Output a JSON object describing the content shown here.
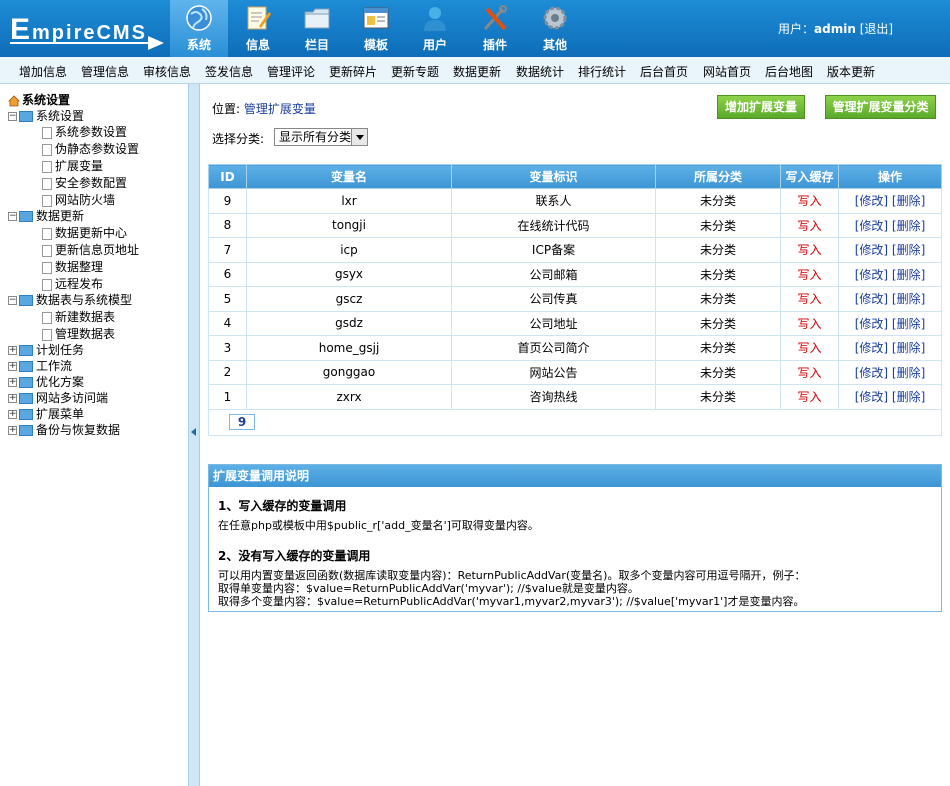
{
  "logo": {
    "text_big": "E",
    "text_rest": "mpireCMS"
  },
  "nav": [
    {
      "label": "系统",
      "icon": "globe-icon",
      "active": true
    },
    {
      "label": "信息",
      "icon": "document-pencil-icon",
      "active": false
    },
    {
      "label": "栏目",
      "icon": "folder-icon",
      "active": false
    },
    {
      "label": "模板",
      "icon": "window-template-icon",
      "active": false
    },
    {
      "label": "用户",
      "icon": "user-icon",
      "active": false
    },
    {
      "label": "插件",
      "icon": "tools-icon",
      "active": false
    },
    {
      "label": "其他",
      "icon": "gear-icon",
      "active": false
    }
  ],
  "user": {
    "prefix": "用户：",
    "name": "admin",
    "logout": "[退出]"
  },
  "submenu": [
    "增加信息",
    "管理信息",
    "审核信息",
    "签发信息",
    "管理评论",
    "更新碎片",
    "更新专题",
    "数据更新",
    "数据统计",
    "排行统计",
    "后台首页",
    "网站首页",
    "后台地图",
    "版本更新"
  ],
  "sidebar": {
    "root": "系统设置",
    "groups": [
      {
        "label": "系统设置",
        "expanded": true,
        "children": [
          "系统参数设置",
          "伪静态参数设置",
          "扩展变量",
          "安全参数配置",
          "网站防火墙"
        ]
      },
      {
        "label": "数据更新",
        "expanded": true,
        "children": [
          "数据更新中心",
          "更新信息页地址",
          "数据整理",
          "远程发布"
        ]
      },
      {
        "label": "数据表与系统模型",
        "expanded": true,
        "children": [
          "新建数据表",
          "管理数据表"
        ]
      },
      {
        "label": "计划任务",
        "expanded": false,
        "children": []
      },
      {
        "label": "工作流",
        "expanded": false,
        "children": []
      },
      {
        "label": "优化方案",
        "expanded": false,
        "children": []
      },
      {
        "label": "网站多访问端",
        "expanded": false,
        "children": []
      },
      {
        "label": "扩展菜单",
        "expanded": false,
        "children": []
      },
      {
        "label": "备份与恢复数据",
        "expanded": false,
        "children": []
      }
    ]
  },
  "location": {
    "prefix": "位置: ",
    "link": "管理扩展变量"
  },
  "buttons": {
    "add_var": "增加扩展变量",
    "manage_class": "管理扩展变量分类"
  },
  "filter": {
    "label": "选择分类:",
    "selected": "显示所有分类"
  },
  "table": {
    "headers": [
      "ID",
      "变量名",
      "变量标识",
      "所属分类",
      "写入缓存",
      "操作"
    ],
    "rows": [
      {
        "id": "9",
        "name": "lxr",
        "title": "联系人",
        "class": "未分类",
        "cache": "写入"
      },
      {
        "id": "8",
        "name": "tongji",
        "title": "在线统计代码",
        "class": "未分类",
        "cache": "写入"
      },
      {
        "id": "7",
        "name": "icp",
        "title": "ICP备案",
        "class": "未分类",
        "cache": "写入"
      },
      {
        "id": "6",
        "name": "gsyx",
        "title": "公司邮箱",
        "class": "未分类",
        "cache": "写入"
      },
      {
        "id": "5",
        "name": "gscz",
        "title": "公司传真",
        "class": "未分类",
        "cache": "写入"
      },
      {
        "id": "4",
        "name": "gsdz",
        "title": "公司地址",
        "class": "未分类",
        "cache": "写入"
      },
      {
        "id": "3",
        "name": "home_gsjj",
        "title": "首页公司简介",
        "class": "未分类",
        "cache": "写入"
      },
      {
        "id": "2",
        "name": "gonggao",
        "title": "网站公告",
        "class": "未分类",
        "cache": "写入"
      },
      {
        "id": "1",
        "name": "zxrx",
        "title": "咨询热线",
        "class": "未分类",
        "cache": "写入"
      }
    ],
    "edit_label": "[修改]",
    "delete_label": "[删除]",
    "total": "9"
  },
  "help": {
    "title": "扩展变量调用说明",
    "h1": "1、写入缓存的变量调用",
    "p1": "在任意php或模板中用$public_r['add_变量名']可取得变量内容。",
    "h2": "2、没有写入缓存的变量调用",
    "p2": "可以用内置变量返回函数(数据库读取变量内容)：ReturnPublicAddVar(变量名)。取多个变量内容可用逗号隔开，例子：",
    "p3": "取得单变量内容：$value=ReturnPublicAddVar('myvar'); //$value就是变量内容。",
    "p4": "取得多个变量内容：$value=ReturnPublicAddVar('myvar1,myvar2,myvar3'); //$value['myvar1']才是变量内容。"
  }
}
